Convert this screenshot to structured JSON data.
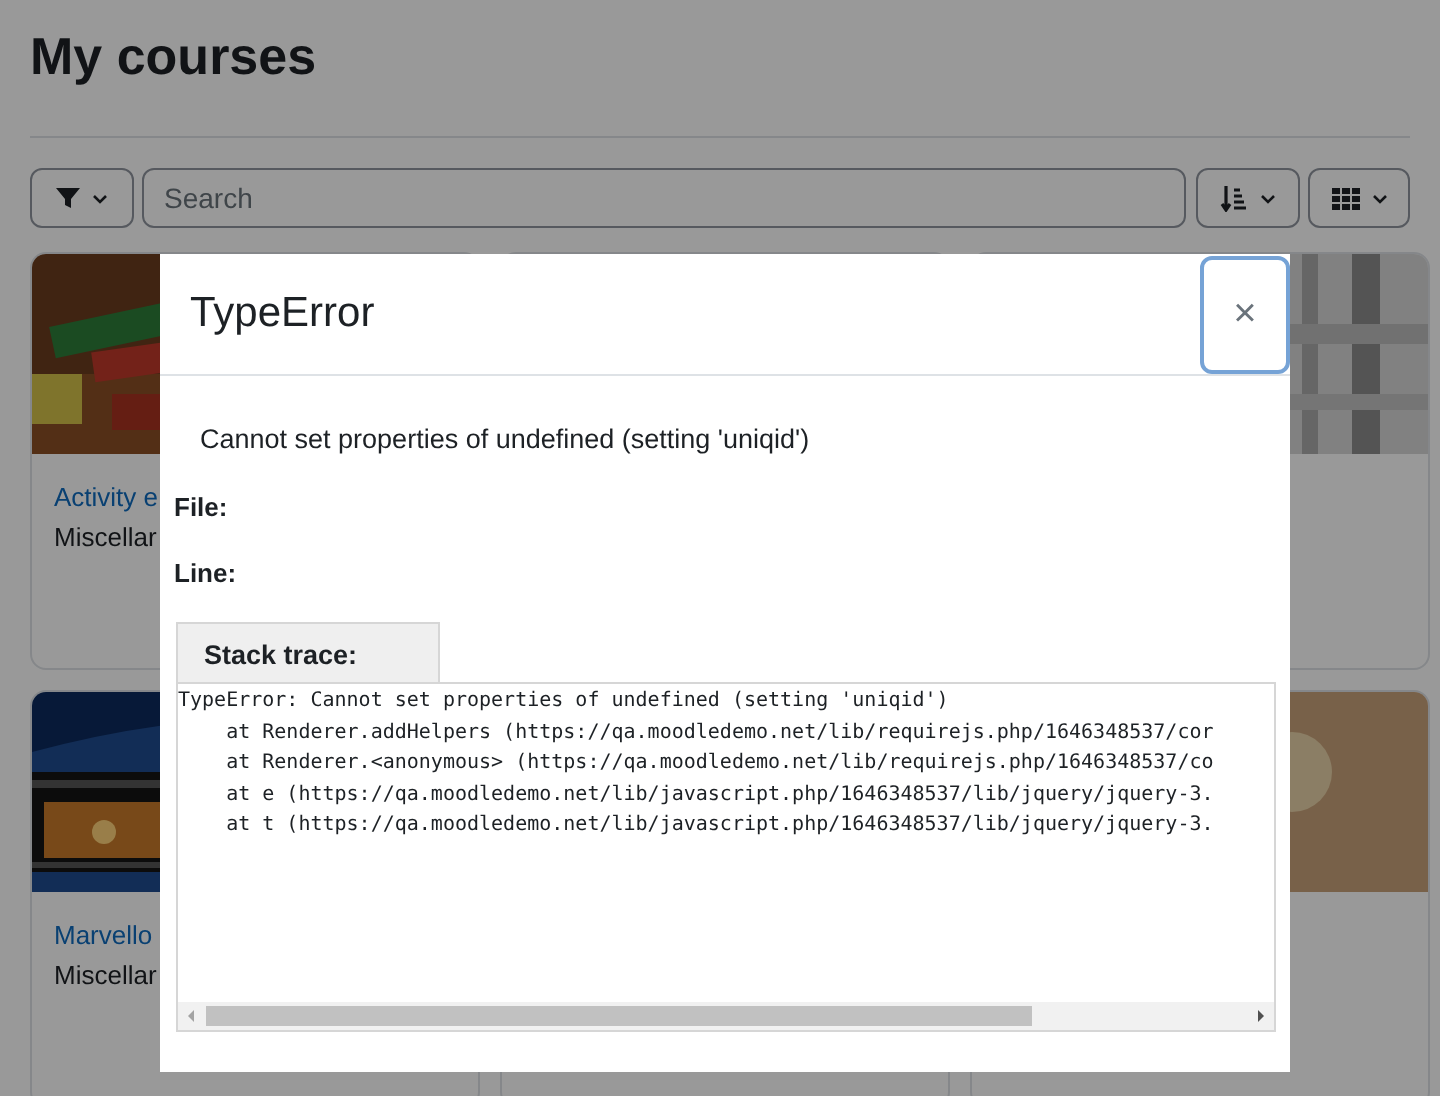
{
  "page": {
    "title": "My courses"
  },
  "toolbar": {
    "search": {
      "placeholder": "Search"
    }
  },
  "courses": [
    {
      "name": "Activity e",
      "category": "Miscellar"
    },
    {
      "name": "Marvello",
      "category": "Miscellar"
    }
  ],
  "dialog": {
    "title": "TypeError",
    "close": "×",
    "message": "Cannot set properties of undefined (setting 'uniqid')",
    "file_label": "File:",
    "line_label": "Line:",
    "stack_tab": "Stack trace:",
    "stack_trace": [
      "TypeError: Cannot set properties of undefined (setting 'uniqid')",
      "    at Renderer.addHelpers (https://qa.moodledemo.net/lib/requirejs.php/1646348537/cor",
      "    at Renderer.<anonymous> (https://qa.moodledemo.net/lib/requirejs.php/1646348537/co",
      "    at e (https://qa.moodledemo.net/lib/javascript.php/1646348537/lib/jquery/jquery-3.",
      "    at t (https://qa.moodledemo.net/lib/javascript.php/1646348537/lib/jquery/jquery-3."
    ]
  }
}
